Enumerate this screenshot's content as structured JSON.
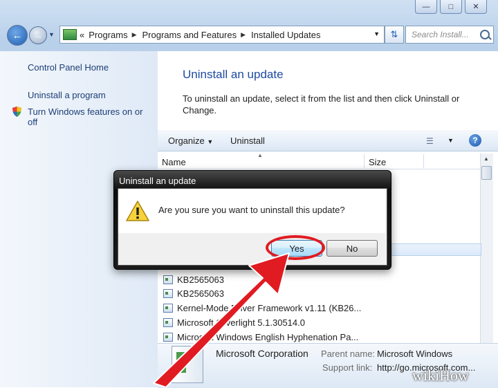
{
  "window": {
    "caption_buttons": [
      "minimize",
      "maximize",
      "close"
    ]
  },
  "nav": {
    "address_path": [
      "Programs",
      "Programs and Features",
      "Installed Updates"
    ],
    "search_placeholder": "Search Install..."
  },
  "sidebar": {
    "items": [
      {
        "label": "Control Panel Home"
      },
      {
        "label": "Uninstall a program"
      },
      {
        "label": "Turn Windows features on or off",
        "line1": "Turn Windows features on or",
        "line2": "off"
      }
    ]
  },
  "main": {
    "title": "Uninstall an update",
    "description": "To uninstall an update, select it from the list and then click Uninstall or Change."
  },
  "toolbar": {
    "organize": "Organize",
    "uninstall": "Uninstall"
  },
  "list": {
    "columns": [
      "Name",
      "Size"
    ],
    "rows": [
      "KB2565063",
      "KB2565063",
      "Kernel-Mode Driver Framework v1.11 (KB26...",
      "Microsoft Silverlight 5.1.30514.0",
      "Microsoft Windows English Hyphenation Pa..."
    ]
  },
  "details": {
    "publisher": "Microsoft Corporation",
    "parent_label": "Parent name:",
    "parent_value": "Microsoft Windows",
    "support_label": "Support link:",
    "support_value": "http://go.microsoft.com..."
  },
  "dialog": {
    "title": "Uninstall an update",
    "message": "Are you sure you want to uninstall this update?",
    "yes": "Yes",
    "no": "No"
  },
  "watermark": "wikiHow",
  "colors": {
    "accent_red": "#e11b22",
    "link": "#1c3e76",
    "title_blue": "#1d4aa0"
  }
}
